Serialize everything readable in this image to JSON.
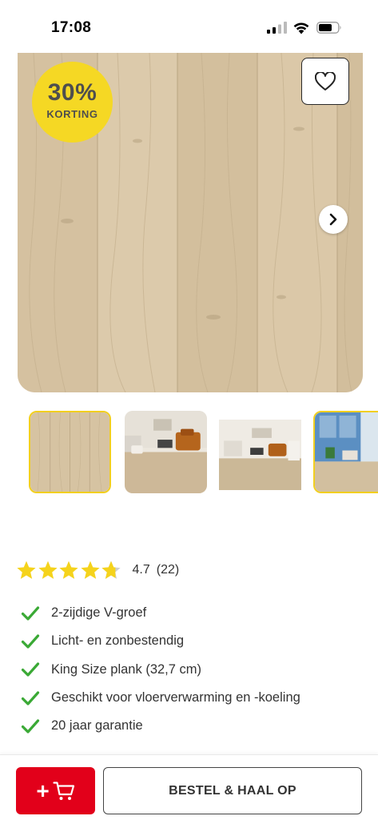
{
  "status_bar": {
    "time": "17:08"
  },
  "product": {
    "discount": {
      "percent": "30%",
      "label": "KORTING"
    },
    "image_count_visible": 4
  },
  "rating": {
    "value": "4.7",
    "count": "(22)",
    "stars": 5
  },
  "features": [
    "2-zijdige V-groef",
    "Licht- en zonbestendig",
    "King Size plank (32,7 cm)",
    "Geschikt voor vloerverwarming en -koeling",
    "20 jaar garantie"
  ],
  "actions": {
    "add_to_cart_symbol": "+",
    "order_label": "BESTEL & HAAL OP"
  },
  "colors": {
    "brand_red": "#e2001a",
    "discount_yellow": "#f5d824",
    "check_green": "#3aa935",
    "star_yellow": "#f5d31c"
  }
}
